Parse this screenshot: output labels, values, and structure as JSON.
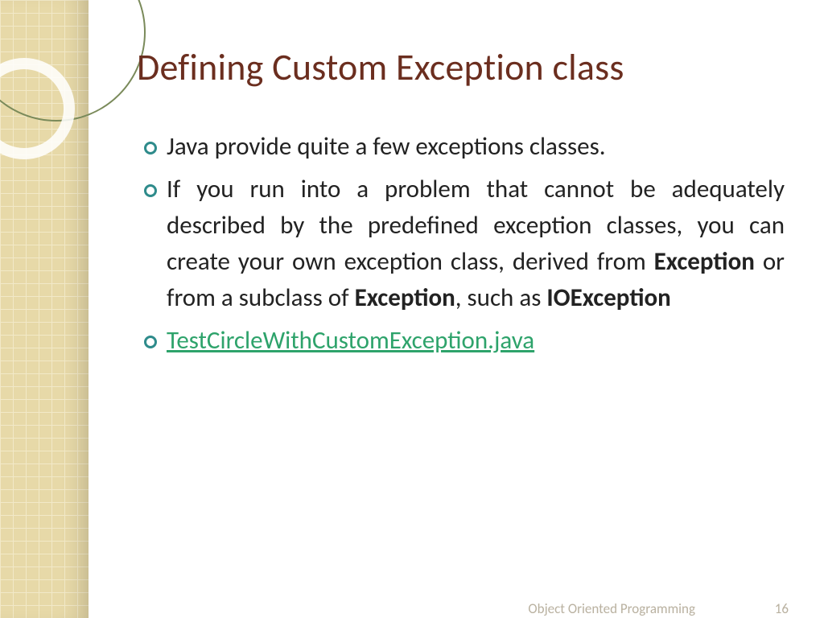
{
  "title": "Defining Custom Exception class",
  "bullets": {
    "b1": "Java provide quite a few exceptions classes.",
    "b2_p1": "If you run into a problem that cannot be adequately described by the predefined exception classes, you can create your own exception class, derived from ",
    "b2_bold1": "Exception",
    "b2_p2": " or from a subclass of ",
    "b2_bold2": "Exception",
    "b2_p3": ", such as ",
    "b2_bold3": "IOException",
    "b3_link": "TestCircleWithCustomException.java"
  },
  "footer": {
    "label": "Object Oriented Programming",
    "page": "16"
  }
}
